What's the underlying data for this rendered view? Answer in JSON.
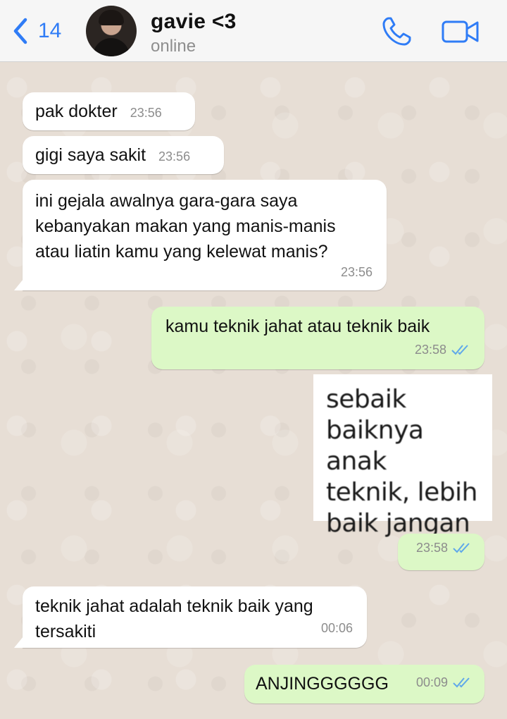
{
  "header": {
    "back_count": "14",
    "contact_name": "gavie <3",
    "contact_status": "online"
  },
  "messages": [
    {
      "text": "pak dokter",
      "time": "23:56",
      "direction": "incoming"
    },
    {
      "text": "gigi saya sakit",
      "time": "23:56",
      "direction": "incoming"
    },
    {
      "lines": [
        "ini gejala awalnya gara-gara saya",
        "kebanyakan makan yang manis-manis",
        "atau liatin kamu yang kelewat manis?"
      ],
      "time": "23:56",
      "direction": "incoming"
    },
    {
      "text": "kamu teknik jahat atau teknik baik",
      "time": "23:58",
      "direction": "outgoing",
      "read": true
    },
    {
      "sticker_lines": [
        "sebaik",
        "baiknya anak",
        "teknik, lebih",
        "baik jangan"
      ],
      "time": "23:58",
      "direction": "outgoing",
      "read": true
    },
    {
      "lines": [
        "teknik jahat adalah teknik baik yang",
        "tersakiti"
      ],
      "time": "00:06",
      "direction": "incoming"
    },
    {
      "text": "ANJINGGGGGG",
      "time": "00:09",
      "direction": "outgoing",
      "read": true
    }
  ],
  "colors": {
    "accent": "#2f7cf6",
    "outgoing_bubble": "#dcf8c6",
    "incoming_bubble": "#ffffff",
    "read_ticks": "#5fa8ea",
    "wallpaper": "#e7ded5"
  },
  "icons": [
    "chevron-left-icon",
    "phone-icon",
    "video-camera-icon",
    "double-check-icon"
  ]
}
